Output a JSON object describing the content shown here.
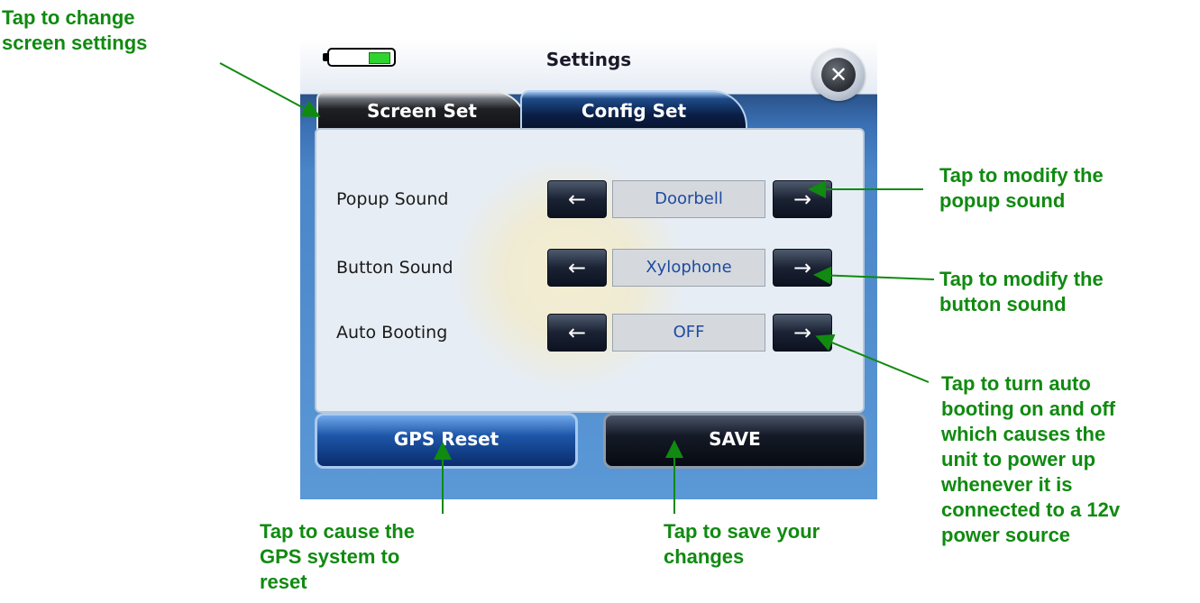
{
  "device": {
    "title": "Settings",
    "close_symbol": "✕",
    "tabs": [
      {
        "label": "Screen Set"
      },
      {
        "label": "Config Set"
      }
    ],
    "rows": [
      {
        "label": "Popup Sound",
        "value": "Doorbell",
        "left_arrow": "←",
        "right_arrow": "→"
      },
      {
        "label": "Button Sound",
        "value": "Xylophone",
        "left_arrow": "←",
        "right_arrow": "→"
      },
      {
        "label": "Auto Booting",
        "value": "OFF",
        "left_arrow": "←",
        "right_arrow": "→"
      }
    ],
    "buttons": {
      "gps_reset": "GPS Reset",
      "save": "SAVE"
    }
  },
  "annotations": {
    "screen_settings": "Tap to change\nscreen settings",
    "popup_sound": "Tap to modify the\npopup sound",
    "button_sound": "Tap to modify the\nbutton sound",
    "auto_booting": "Tap to turn auto\nbooting on and off\nwhich causes the\nunit to power up\nwhenever it is\nconnected to a  12v\npower source",
    "gps_reset": "Tap to cause the\nGPS system to\nreset",
    "save": "Tap to save your\nchanges"
  },
  "colors": {
    "annotation_text": "#108a10",
    "value_text": "#1f4aa0",
    "battery_level": "#2fd32f"
  },
  "icons": [
    "battery-icon",
    "close-icon",
    "left-arrow-icon",
    "right-arrow-icon"
  ]
}
